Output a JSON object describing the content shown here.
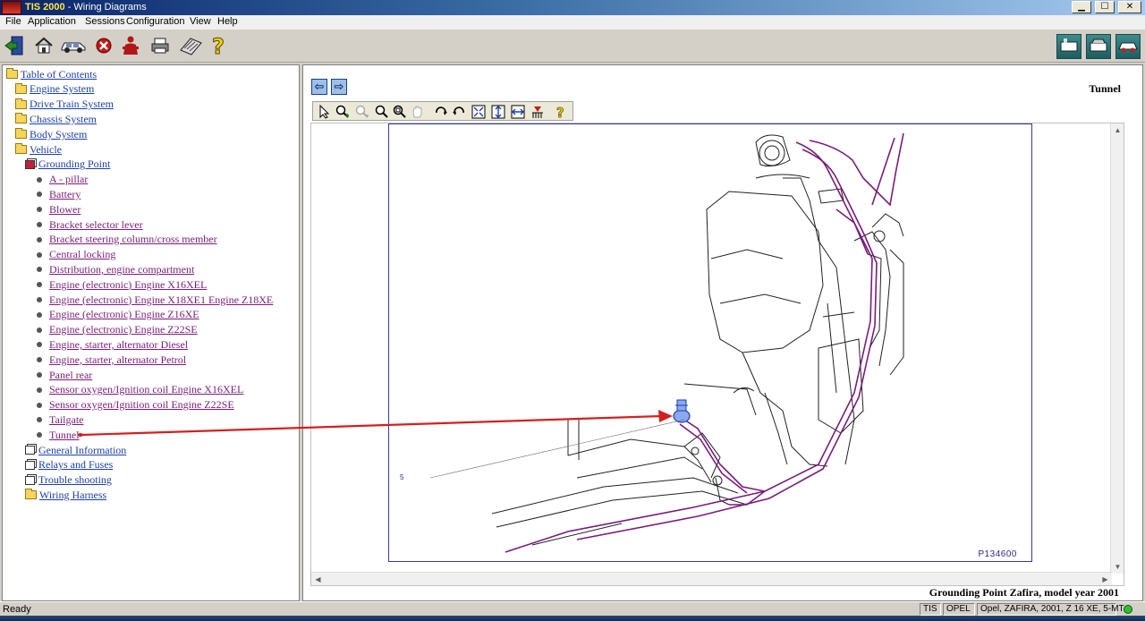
{
  "window": {
    "app_name": "TIS 2000",
    "title_suffix": " - Wiring Diagrams",
    "controls": {
      "minimize": "▁",
      "maximize": "☐",
      "close": "✕"
    }
  },
  "menu": {
    "items": [
      "File",
      "Application",
      "Sessions",
      "Configuration",
      "View",
      "Help"
    ]
  },
  "toolbar": {
    "buttons": [
      "exit-icon",
      "home-icon",
      "vehicle-icon",
      "stop-icon",
      "person-icon",
      "print-icon",
      "notepad-icon",
      "help-icon"
    ],
    "right_buttons": [
      "module-a-icon",
      "module-b-icon",
      "module-c-icon"
    ]
  },
  "tree": {
    "items": [
      {
        "label": "Table of Contents",
        "level": 0,
        "icon": "folder-open-icon"
      },
      {
        "label": "Engine System",
        "level": 1,
        "icon": "folder-icon"
      },
      {
        "label": "Drive Train System",
        "level": 1,
        "icon": "folder-icon"
      },
      {
        "label": "Chassis System",
        "level": 1,
        "icon": "folder-icon"
      },
      {
        "label": "Body System",
        "level": 1,
        "icon": "folder-icon"
      },
      {
        "label": "Vehicle",
        "level": 1,
        "icon": "folder-open-icon"
      },
      {
        "label": "Grounding Point",
        "level": 2,
        "icon": "book-open-icon"
      },
      {
        "label": "A - pillar",
        "level": 3,
        "icon": "bullet-icon"
      },
      {
        "label": "Battery",
        "level": 3,
        "icon": "bullet-icon"
      },
      {
        "label": "Blower",
        "level": 3,
        "icon": "bullet-icon"
      },
      {
        "label": "Bracket selector lever",
        "level": 3,
        "icon": "bullet-icon"
      },
      {
        "label": "Bracket steering column/cross member",
        "level": 3,
        "icon": "bullet-icon"
      },
      {
        "label": "Central locking",
        "level": 3,
        "icon": "bullet-icon"
      },
      {
        "label": "Distribution, engine compartment",
        "level": 3,
        "icon": "bullet-icon"
      },
      {
        "label": "Engine (electronic) Engine X16XEL",
        "level": 3,
        "icon": "bullet-icon"
      },
      {
        "label": "Engine (electronic) Engine X18XE1 Engine Z18XE",
        "level": 3,
        "icon": "bullet-icon"
      },
      {
        "label": "Engine (electronic) Engine Z16XE",
        "level": 3,
        "icon": "bullet-icon"
      },
      {
        "label": "Engine (electronic) Engine Z22SE",
        "level": 3,
        "icon": "bullet-icon"
      },
      {
        "label": "Engine, starter, alternator Diesel",
        "level": 3,
        "icon": "bullet-icon"
      },
      {
        "label": "Engine, starter, alternator Petrol",
        "level": 3,
        "icon": "bullet-icon"
      },
      {
        "label": "Panel rear",
        "level": 3,
        "icon": "bullet-icon"
      },
      {
        "label": "Sensor oxygen/Ignition coil Engine X16XEL",
        "level": 3,
        "icon": "bullet-icon"
      },
      {
        "label": "Sensor oxygen/Ignition coil Engine Z22SE",
        "level": 3,
        "icon": "bullet-icon"
      },
      {
        "label": "Tailgate",
        "level": 3,
        "icon": "bullet-icon"
      },
      {
        "label": "Tunnel",
        "level": 3,
        "icon": "bullet-icon"
      },
      {
        "label": "General Information",
        "level": 2,
        "icon": "book-icon"
      },
      {
        "label": "Relays and Fuses",
        "level": 2,
        "icon": "book-icon"
      },
      {
        "label": "Trouble shooting",
        "level": 2,
        "icon": "book-icon"
      },
      {
        "label": "Wiring Harness",
        "level": 2,
        "icon": "folder-icon"
      }
    ]
  },
  "document": {
    "title": "Tunnel",
    "figure_number": "P134600",
    "callout_number": "5",
    "caption": "Grounding Point Zafira, model year 2001",
    "nav": [
      "back-arrow-icon",
      "forward-arrow-icon"
    ],
    "viewer_tools": [
      "select-icon",
      "zoom-in-icon",
      "zoom-out-disabled-icon",
      "pan-icon",
      "zoom-icon",
      "zoom-window-icon",
      "rotate-cw-icon",
      "rotate-ccw-icon",
      "fit-page-icon",
      "fit-height-icon",
      "fit-width-icon",
      "measure-icon",
      "help-icon"
    ]
  },
  "status": {
    "text": "Ready",
    "cells": [
      "TIS",
      "OPEL",
      "Opel, ZAFIRA, 2001, Z 16 XE, 5-MT"
    ]
  },
  "colors": {
    "wire": "#7a1c7a",
    "annotation_arrow": "#d42020",
    "link": "#1c3fa8",
    "visited_link": "#7a1c7a"
  }
}
